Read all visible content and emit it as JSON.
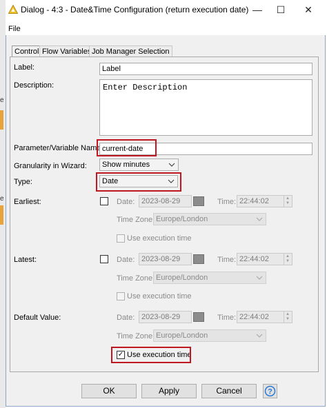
{
  "window": {
    "title": "Dialog - 4:3 - Date&Time Configuration (return execution date)",
    "minimize": "—",
    "maximize": "☐",
    "close": "✕"
  },
  "menu": {
    "file": "File"
  },
  "tabs": [
    "Control",
    "Flow Variables",
    "Job Manager Selection"
  ],
  "form": {
    "label_label": "Label:",
    "label_value": "Label",
    "description_label": "Description:",
    "description_value": "Enter Description",
    "param_label": "Parameter/Variable Name:",
    "param_value": "current-date",
    "granularity_label": "Granularity in Wizard:",
    "granularity_value": "Show minutes",
    "type_label": "Type:",
    "type_value": "Date"
  },
  "earliest": {
    "label": "Earliest:",
    "date_label": "Date:",
    "date_value": "2023-08-29",
    "time_label": "Time:",
    "time_value": "22:44:02",
    "tz_label": "Time Zone:",
    "tz_value": "Europe/London",
    "use_exec": "Use execution time"
  },
  "latest": {
    "label": "Latest:",
    "date_label": "Date:",
    "date_value": "2023-08-29",
    "time_label": "Time:",
    "time_value": "22:44:02",
    "tz_label": "Time Zone:",
    "tz_value": "Europe/London",
    "use_exec": "Use execution time"
  },
  "default": {
    "label": "Default Value:",
    "date_label": "Date:",
    "date_value": "2023-08-29",
    "time_label": "Time:",
    "time_value": "22:44:02",
    "tz_label": "Time Zone:",
    "tz_value": "Europe/London",
    "use_exec": "Use execution time",
    "use_exec_checked": "✓"
  },
  "buttons": {
    "ok": "OK",
    "apply": "Apply",
    "cancel": "Cancel",
    "help": "?"
  },
  "background": {
    "text1": "e",
    "text2": "e"
  },
  "colors": {
    "highlight": "#c0161f",
    "help_blue": "#2a7bd6",
    "logo_yellow": "#f2c12e"
  }
}
